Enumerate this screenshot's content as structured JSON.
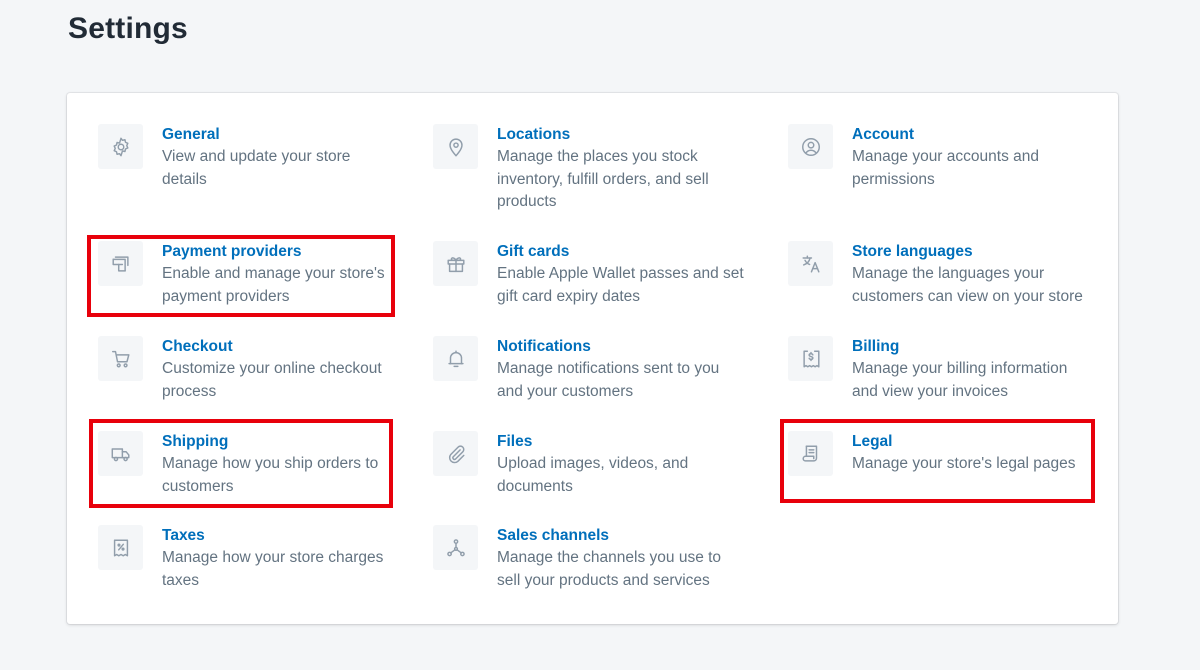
{
  "page": {
    "title": "Settings"
  },
  "colors": {
    "accent": "#006fbb",
    "highlight": "#e8000b",
    "background": "#f4f6f8",
    "icon": "#919eab"
  },
  "settings": {
    "general": {
      "title": "General",
      "description": "View and update your store details",
      "icon": "gear-icon"
    },
    "locations": {
      "title": "Locations",
      "description": "Manage the places you stock inventory, fulfill orders, and sell products",
      "icon": "location-pin-icon"
    },
    "account": {
      "title": "Account",
      "description": "Manage your accounts and permissions",
      "icon": "user-circle-icon"
    },
    "payment_providers": {
      "title": "Payment providers",
      "description": "Enable and manage your store's payment providers",
      "icon": "payment-card-icon"
    },
    "gift_cards": {
      "title": "Gift cards",
      "description": "Enable Apple Wallet passes and set gift card expiry dates",
      "icon": "gift-icon"
    },
    "store_languages": {
      "title": "Store languages",
      "description": "Manage the languages your customers can view on your store",
      "icon": "translate-icon"
    },
    "checkout": {
      "title": "Checkout",
      "description": "Customize your online checkout process",
      "icon": "cart-icon"
    },
    "notifications": {
      "title": "Notifications",
      "description": "Manage notifications sent to you and your customers",
      "icon": "bell-icon"
    },
    "billing": {
      "title": "Billing",
      "description": "Manage your billing information and view your invoices",
      "icon": "invoice-dollar-icon"
    },
    "shipping": {
      "title": "Shipping",
      "description": "Manage how you ship orders to customers",
      "icon": "truck-icon"
    },
    "files": {
      "title": "Files",
      "description": "Upload images, videos, and documents",
      "icon": "paperclip-icon"
    },
    "legal": {
      "title": "Legal",
      "description": "Manage your store's legal pages",
      "icon": "legal-document-icon"
    },
    "taxes": {
      "title": "Taxes",
      "description": "Manage how your store charges taxes",
      "icon": "tax-receipt-icon"
    },
    "sales_channels": {
      "title": "Sales channels",
      "description": "Manage the channels you use to sell your products and services",
      "icon": "channels-icon"
    }
  },
  "highlighted_items": [
    "Payment providers",
    "Shipping",
    "Legal"
  ]
}
